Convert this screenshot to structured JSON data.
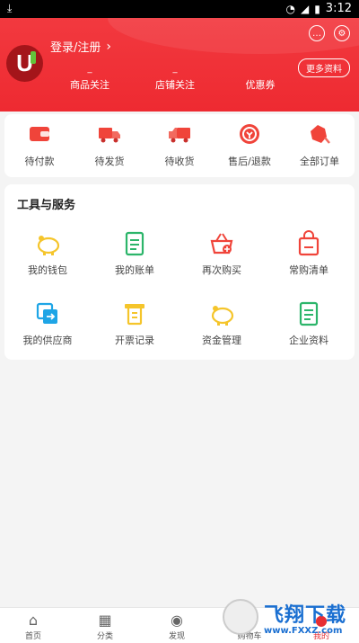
{
  "status_bar": {
    "time": "3:12"
  },
  "header": {
    "login_label": "登录/注册",
    "more_label": "更多资料",
    "stats": [
      {
        "value": "_",
        "label": "商品关注"
      },
      {
        "value": "_",
        "label": "店铺关注"
      },
      {
        "value": "",
        "label": "优惠券"
      }
    ]
  },
  "orders": [
    {
      "label": "待付款",
      "icon": "wallet-icon",
      "color": "#f0443a"
    },
    {
      "label": "待发货",
      "icon": "truck-icon",
      "color": "#f0443a"
    },
    {
      "label": "待收货",
      "icon": "delivery-truck-icon",
      "color": "#f0443a"
    },
    {
      "label": "售后/退款",
      "icon": "refund-icon",
      "color": "#f0443a"
    },
    {
      "label": "全部订单",
      "icon": "all-orders-icon",
      "color": "#f0443a"
    }
  ],
  "tools": {
    "title": "工具与服务",
    "items": [
      {
        "label": "我的钱包",
        "icon": "piggy-bank-icon",
        "color": "#f5c52b"
      },
      {
        "label": "我的账单",
        "icon": "bill-icon",
        "color": "#2cb56a"
      },
      {
        "label": "再次购买",
        "icon": "basket-plus-icon",
        "color": "#f0443a"
      },
      {
        "label": "常购清单",
        "icon": "shopping-bag-icon",
        "color": "#f0443a"
      },
      {
        "label": "我的供应商",
        "icon": "supplier-icon",
        "color": "#1ea5e6"
      },
      {
        "label": "开票记录",
        "icon": "invoice-icon",
        "color": "#f5c52b"
      },
      {
        "label": "资金管理",
        "icon": "fund-piggy-icon",
        "color": "#f5c52b"
      },
      {
        "label": "企业资料",
        "icon": "company-doc-icon",
        "color": "#2cb56a"
      }
    ]
  },
  "tabbar": [
    {
      "label": "首页",
      "icon": "home-icon"
    },
    {
      "label": "分类",
      "icon": "grid-icon"
    },
    {
      "label": "发现",
      "icon": "location-icon"
    },
    {
      "label": "购物车",
      "icon": "cart-icon"
    },
    {
      "label": "我的",
      "icon": "user-icon"
    }
  ],
  "watermark": {
    "title": "飞翔下载",
    "url": "www.FXXZ.com"
  }
}
